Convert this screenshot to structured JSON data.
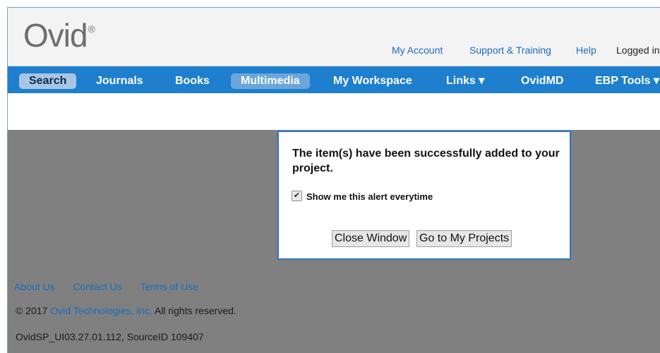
{
  "header": {
    "logo_text": "Ovid",
    "logo_mark": "®",
    "links": {
      "my_account": "My Account",
      "support_training": "Support & Training",
      "help": "Help",
      "logged_in": "Logged in"
    }
  },
  "nav": {
    "search": "Search",
    "journals": "Journals",
    "books": "Books",
    "multimedia": "Multimedia",
    "my_workspace": "My Workspace",
    "links": "Links ▾",
    "ovidmd": "OvidMD",
    "ebp_tools": "EBP Tools ▾"
  },
  "dialog": {
    "message": "The item(s) have been successfully added to your project.",
    "checkbox_label": "Show me this alert everytime",
    "checkbox_checked": true,
    "close_button": "Close Window",
    "projects_button": "Go to My Projects"
  },
  "footer": {
    "about": "About Us",
    "contact": "Contact Us",
    "terms": "Terms of Use",
    "copyright_prefix": "© 2017",
    "company": "Ovid Technologies, Inc.",
    "copyright_suffix": "All rights reserved.",
    "version": "OvidSP_UI03.27.01.112, SourceID 109407"
  }
}
